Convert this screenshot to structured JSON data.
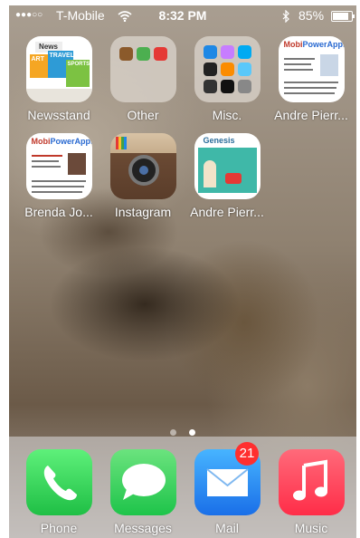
{
  "status_bar": {
    "signal": "●●●○○",
    "carrier": "T-Mobile",
    "time": "8:32 PM",
    "battery_percent": "85%",
    "battery_level": 0.85,
    "wifi_icon": "wifi-icon",
    "bluetooth_icon": "bluetooth-icon"
  },
  "home_apps": [
    {
      "label": "Newsstand"
    },
    {
      "label": "Other"
    },
    {
      "label": "Misc."
    },
    {
      "label": "Andre Pierr..."
    },
    {
      "label": "Brenda Jo..."
    },
    {
      "label": "Instagram"
    },
    {
      "label": "Andre Pierr..."
    }
  ],
  "newsstand_words": [
    "News",
    "ART",
    "TRAVEL",
    "SPORTS"
  ],
  "card_brand": {
    "mobi": "Mobi",
    "power": "Power",
    "apps": "Apps"
  },
  "genesis_text": "Genesis",
  "page_dots": {
    "count": 2,
    "active": 2
  },
  "dock": [
    {
      "label": "Phone",
      "icon": "phone-icon"
    },
    {
      "label": "Messages",
      "icon": "messages-icon"
    },
    {
      "label": "Mail",
      "icon": "mail-icon",
      "badge": "21"
    },
    {
      "label": "Music",
      "icon": "music-icon"
    }
  ],
  "colors": {
    "phone": "#2fd158",
    "messages": "#34c759",
    "mail": "#1a8cff",
    "music": "#ff3b50",
    "badge": "#ff2f2f"
  }
}
